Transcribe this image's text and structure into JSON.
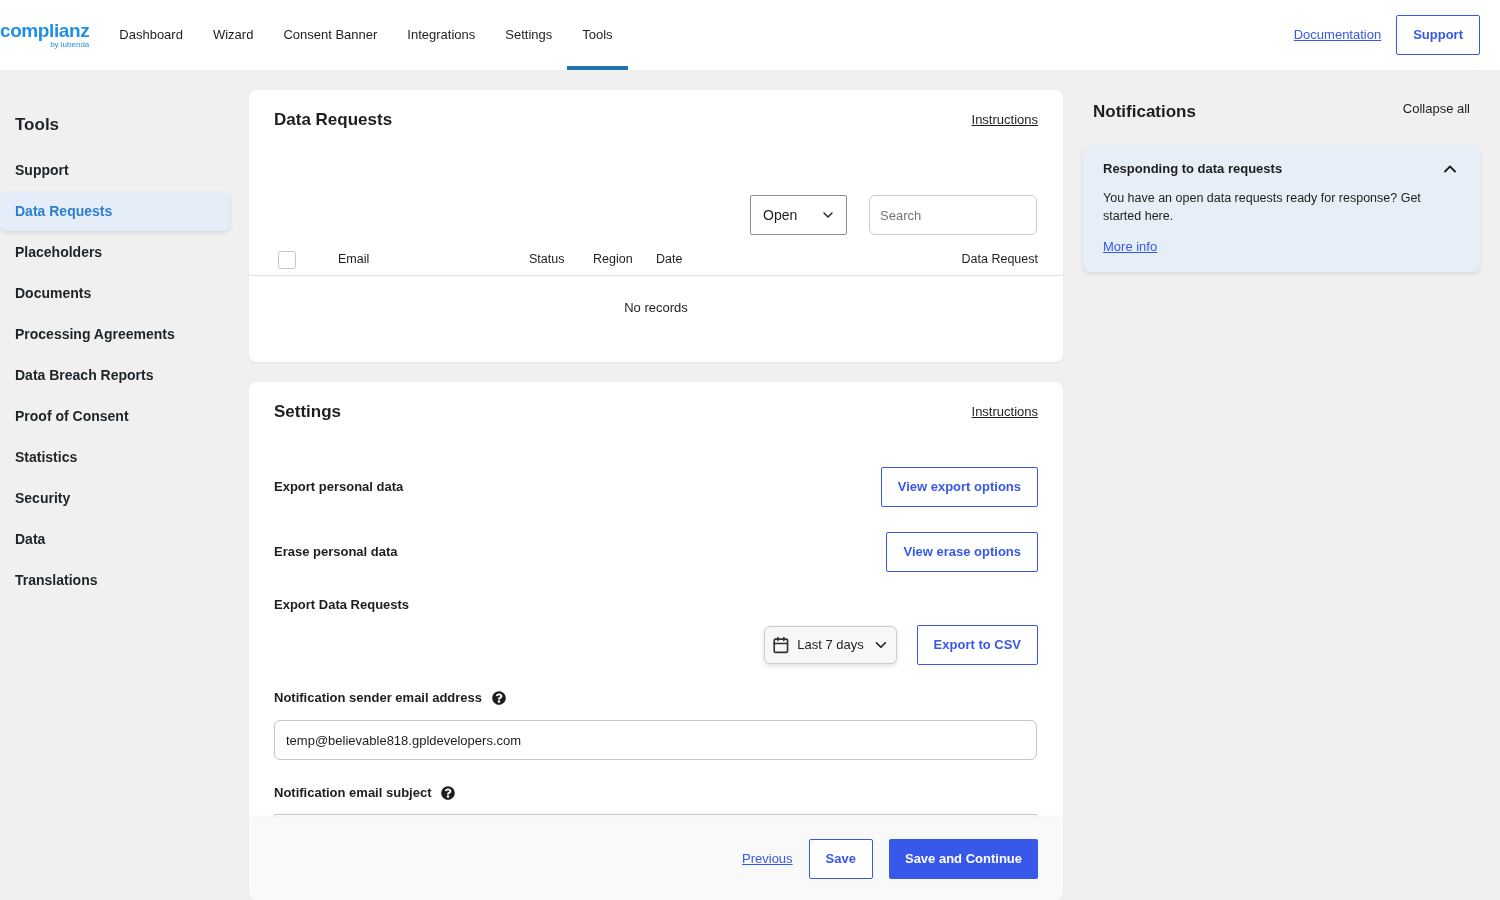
{
  "header": {
    "logo": {
      "wordmark": "complianz",
      "tagline": "by iubenda"
    },
    "nav": [
      {
        "label": "Dashboard",
        "selected": false
      },
      {
        "label": "Wizard",
        "selected": false
      },
      {
        "label": "Consent Banner",
        "selected": false
      },
      {
        "label": "Integrations",
        "selected": false
      },
      {
        "label": "Settings",
        "selected": false
      },
      {
        "label": "Tools",
        "selected": true
      }
    ],
    "documentation_link": "Documentation",
    "support_button": "Support"
  },
  "sidebar": {
    "title": "Tools",
    "items": [
      {
        "label": "Support",
        "selected": false
      },
      {
        "label": "Data Requests",
        "selected": true
      },
      {
        "label": "Placeholders",
        "selected": false
      },
      {
        "label": "Documents",
        "selected": false
      },
      {
        "label": "Processing Agreements",
        "selected": false
      },
      {
        "label": "Data Breach Reports",
        "selected": false
      },
      {
        "label": "Proof of Consent",
        "selected": false
      },
      {
        "label": "Statistics",
        "selected": false
      },
      {
        "label": "Security",
        "selected": false
      },
      {
        "label": "Data",
        "selected": false
      },
      {
        "label": "Translations",
        "selected": false
      }
    ]
  },
  "data_requests": {
    "title": "Data Requests",
    "instructions_link": "Instructions",
    "status_select": {
      "value": "Open"
    },
    "search": {
      "placeholder": "Search"
    },
    "table": {
      "select_all_checked": false,
      "columns": [
        "Email",
        "Status",
        "Region",
        "Date",
        "Data Request"
      ],
      "empty_message": "No records"
    }
  },
  "settings": {
    "title": "Settings",
    "instructions_link": "Instructions",
    "rows": [
      {
        "kind": "button",
        "label": "Export personal data",
        "button": "View export options"
      },
      {
        "kind": "button",
        "label": "Erase personal data",
        "button": "View erase options"
      },
      {
        "kind": "export",
        "label": "Export Data Requests",
        "range": "Last 7 days",
        "button": "Export to CSV"
      },
      {
        "kind": "input",
        "label": "Notification sender email address",
        "help": true,
        "value": "temp@believable818.gpldevelopers.com"
      },
      {
        "kind": "input",
        "label": "Notification email subject",
        "help": true
      }
    ]
  },
  "footer": {
    "previous_link": "Previous",
    "save_button": "Save",
    "save_continue_button": "Save and Continue"
  },
  "notifications": {
    "title": "Notifications",
    "collapse_all": "Collapse all",
    "items": [
      {
        "title": "Responding to data requests",
        "expanded": true,
        "text": "You have an open data requests ready for response? Get started here.",
        "link": "More info"
      }
    ]
  }
}
